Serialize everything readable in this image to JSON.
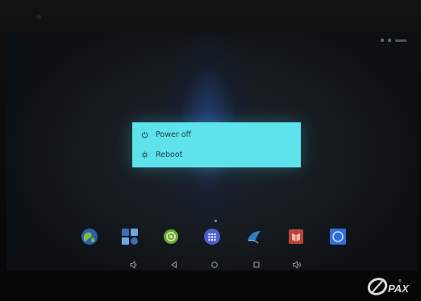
{
  "device": {
    "brand_logo_text": "PAX"
  },
  "power_menu": {
    "items": [
      {
        "label": "Power off",
        "icon": "power-icon"
      },
      {
        "label": "Reboot",
        "icon": "reboot-icon"
      }
    ]
  },
  "dock": {
    "apps": [
      {
        "icon": "browser-icon",
        "color": "#4a7bc4"
      },
      {
        "icon": "apps-store-icon",
        "color": "#3a6fb0"
      },
      {
        "icon": "settings-icon",
        "color": "#7bb23a"
      },
      {
        "icon": "app-drawer-icon",
        "color": "#4b5fd0"
      },
      {
        "icon": "bird-app-icon",
        "color": "#2f7fc0"
      },
      {
        "icon": "book-app-icon",
        "color": "#c44a3c"
      },
      {
        "icon": "camera-app-icon",
        "color": "#3e7fe6"
      }
    ]
  },
  "nav_bar": {
    "buttons": [
      {
        "icon": "volume-down-icon"
      },
      {
        "icon": "back-icon"
      },
      {
        "icon": "home-icon"
      },
      {
        "icon": "recents-icon"
      },
      {
        "icon": "volume-up-icon"
      }
    ]
  },
  "colors": {
    "dialog_bg": "#5ee3ec",
    "dialog_text": "#1b3b45",
    "nav_icon": "#8a93a0"
  }
}
